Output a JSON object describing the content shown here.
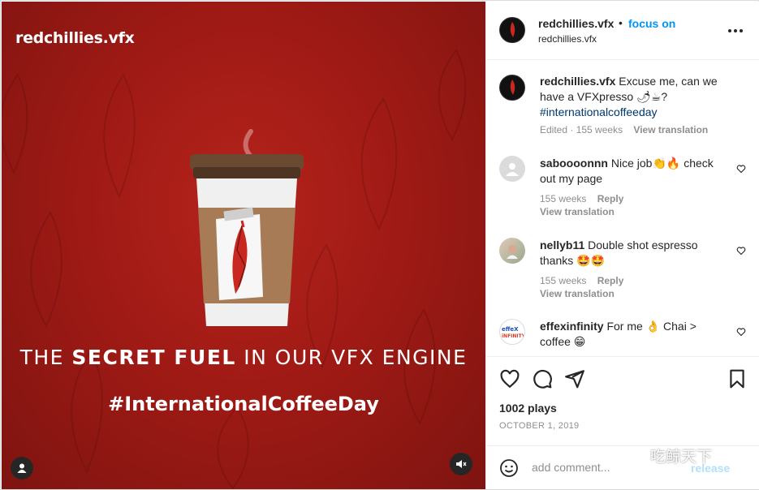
{
  "post": {
    "brand_logo": "redchillies.vfx",
    "headline_part1": "THE",
    "headline_bold": "SECRET FUEL",
    "headline_part2": "IN OUR VFX ENGINE",
    "hashtag": "#InternationalCoffeeDay"
  },
  "header": {
    "username": "redchillies.vfx",
    "dot": "•",
    "follow_label": "focus on",
    "subtitle": "redchillies.vfx"
  },
  "caption": {
    "username": "redchillies.vfx",
    "text": "Excuse me, can we have a VFXpresso 🌶☕?",
    "hashtag": "#internationalcoffeeday",
    "edited": "Edited",
    "age": "· 155 weeks",
    "view_translation": "View translation"
  },
  "comments": [
    {
      "username": "saboooonnn",
      "text": "Nice job👏🔥 check out my page",
      "age": "155 weeks",
      "reply": "Reply",
      "view_translation": "View translation"
    },
    {
      "username": "nellyb11",
      "text": "Double shot espresso thanks 🤩🤩",
      "age": "155 weeks",
      "reply": "Reply",
      "view_translation": "View translation"
    },
    {
      "username": "effexinfinity",
      "text": "For me 👌 Chai > coffee 😁"
    }
  ],
  "stats": {
    "plays": "1002 plays",
    "date": "OCTOBER 1, 2019"
  },
  "composer": {
    "placeholder": "add comment...",
    "release_label": "release"
  },
  "watermark": "吃鲸天下",
  "colors": {
    "accent": "#0095f6",
    "media_red": "#a01a15",
    "muted_text": "#8e8e8e"
  }
}
